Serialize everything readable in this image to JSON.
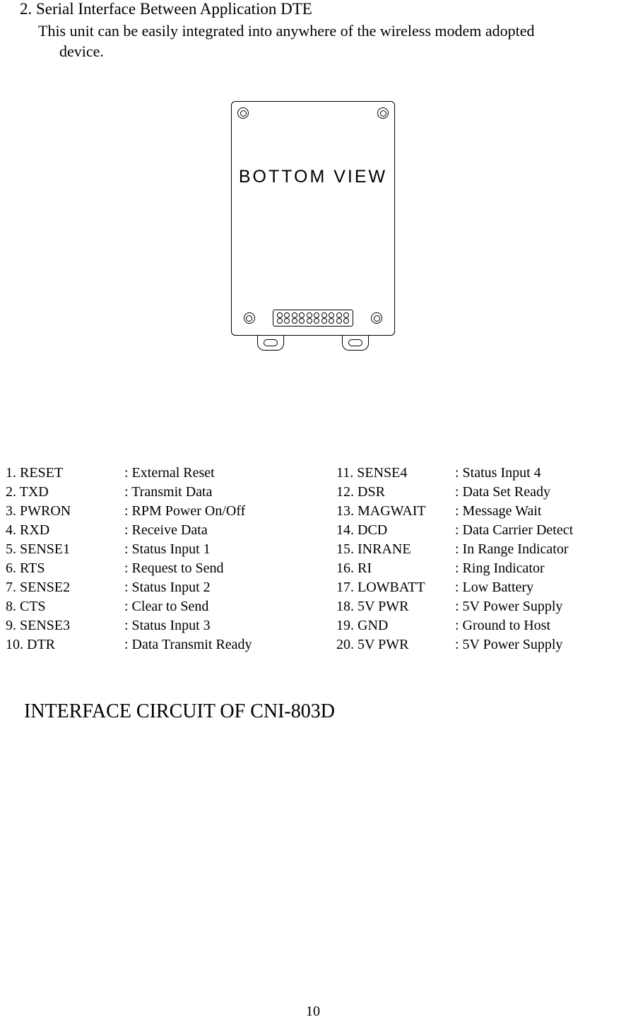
{
  "heading": "2. Serial Interface Between Application DTE",
  "paragraph_line1": "This unit can be easily integrated into anywhere of the wireless modem adopted",
  "paragraph_line2": "device.",
  "diagram_label": "BOTTOM VIEW",
  "pins_left": [
    {
      "label": "1. RESET",
      "desc": ": External Reset"
    },
    {
      "label": "2. TXD",
      "desc": ": Transmit Data"
    },
    {
      "label": "3. PWRON",
      "desc": ": RPM Power On/Off"
    },
    {
      "label": "4. RXD",
      "desc": ": Receive Data"
    },
    {
      "label": "5. SENSE1",
      "desc": ": Status Input 1"
    },
    {
      "label": "6. RTS",
      "desc": ": Request to Send"
    },
    {
      "label": "7. SENSE2",
      "desc": ": Status Input 2"
    },
    {
      "label": "8. CTS",
      "desc": ": Clear to Send"
    },
    {
      "label": "9. SENSE3",
      "desc": ": Status Input 3"
    },
    {
      "label": "10. DTR",
      "desc": ": Data Transmit Ready"
    }
  ],
  "pins_right": [
    {
      "label": "11. SENSE4",
      "desc": ": Status Input 4"
    },
    {
      "label": "12. DSR",
      "desc": ": Data Set Ready"
    },
    {
      "label": "13. MAGWAIT",
      "desc": ": Message Wait"
    },
    {
      "label": "14. DCD",
      "desc": ": Data Carrier Detect"
    },
    {
      "label": "15. INRANE",
      "desc": ": In Range Indicator"
    },
    {
      "label": "16. RI",
      "desc": ": Ring Indicator"
    },
    {
      "label": "17. LOWBATT",
      "desc": ": Low Battery"
    },
    {
      "label": "18. 5V PWR",
      "desc": ": 5V Power Supply"
    },
    {
      "label": "19. GND",
      "desc": ": Ground to Host"
    },
    {
      "label": "20. 5V PWR",
      "desc": ": 5V Power Supply"
    }
  ],
  "circuit_heading": "INTERFACE CIRCUIT OF CNI-803D",
  "page_number": "10"
}
